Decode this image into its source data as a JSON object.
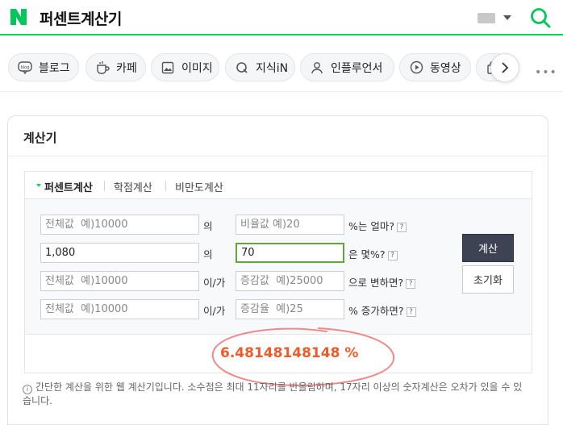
{
  "header": {
    "title": "퍼센트계산기"
  },
  "tabs": [
    {
      "label": "블로그",
      "icon": "blog-icon"
    },
    {
      "label": "카페",
      "icon": "cafe-icon"
    },
    {
      "label": "이미지",
      "icon": "image-icon"
    },
    {
      "label": "지식iN",
      "icon": "kin-icon"
    },
    {
      "label": "인플루언서",
      "icon": "influencer-icon"
    },
    {
      "label": "동영상",
      "icon": "video-icon"
    },
    {
      "label": "",
      "icon": "shopping-icon"
    }
  ],
  "card": {
    "title": "계산기"
  },
  "subtabs": [
    "퍼센트계산",
    "학점계산",
    "비만도계산"
  ],
  "rows": [
    {
      "field1": {
        "value": "",
        "placeholder": "전체값  예)10000"
      },
      "mid": "의",
      "field2": {
        "value": "",
        "placeholder": "비율값 예)20"
      },
      "suffix": "%는 얼마?"
    },
    {
      "field1": {
        "value": "1,080",
        "placeholder": ""
      },
      "mid": "의",
      "field2": {
        "value": "70",
        "placeholder": ""
      },
      "suffix": "은 몇%?"
    },
    {
      "field1": {
        "value": "",
        "placeholder": "전체값  예)10000"
      },
      "mid": "이/가",
      "field2": {
        "value": "",
        "placeholder": "증감값  예)25000"
      },
      "suffix": "으로 변하면?"
    },
    {
      "field1": {
        "value": "",
        "placeholder": "전체값  예)10000"
      },
      "mid": "이/가",
      "field2": {
        "value": "",
        "placeholder": "증감율  예)25"
      },
      "suffix": "% 증가하면?"
    }
  ],
  "help_mark": "?",
  "buttons": {
    "calc": "계산",
    "reset": "초기화"
  },
  "result": "6.48148148148 %",
  "note": "간단한 계산을 위한 웹 계산기입니다. 소수점은 최대 11자리를 반올림하며, 17자리 이상의 숫자계산은 오차가 있을 수 있습니다.",
  "note_icon": "i",
  "colors": {
    "brand": "#19ce60",
    "result": "#f05a28",
    "calc_button": "#3d4352",
    "focus": "#5fa73a"
  }
}
